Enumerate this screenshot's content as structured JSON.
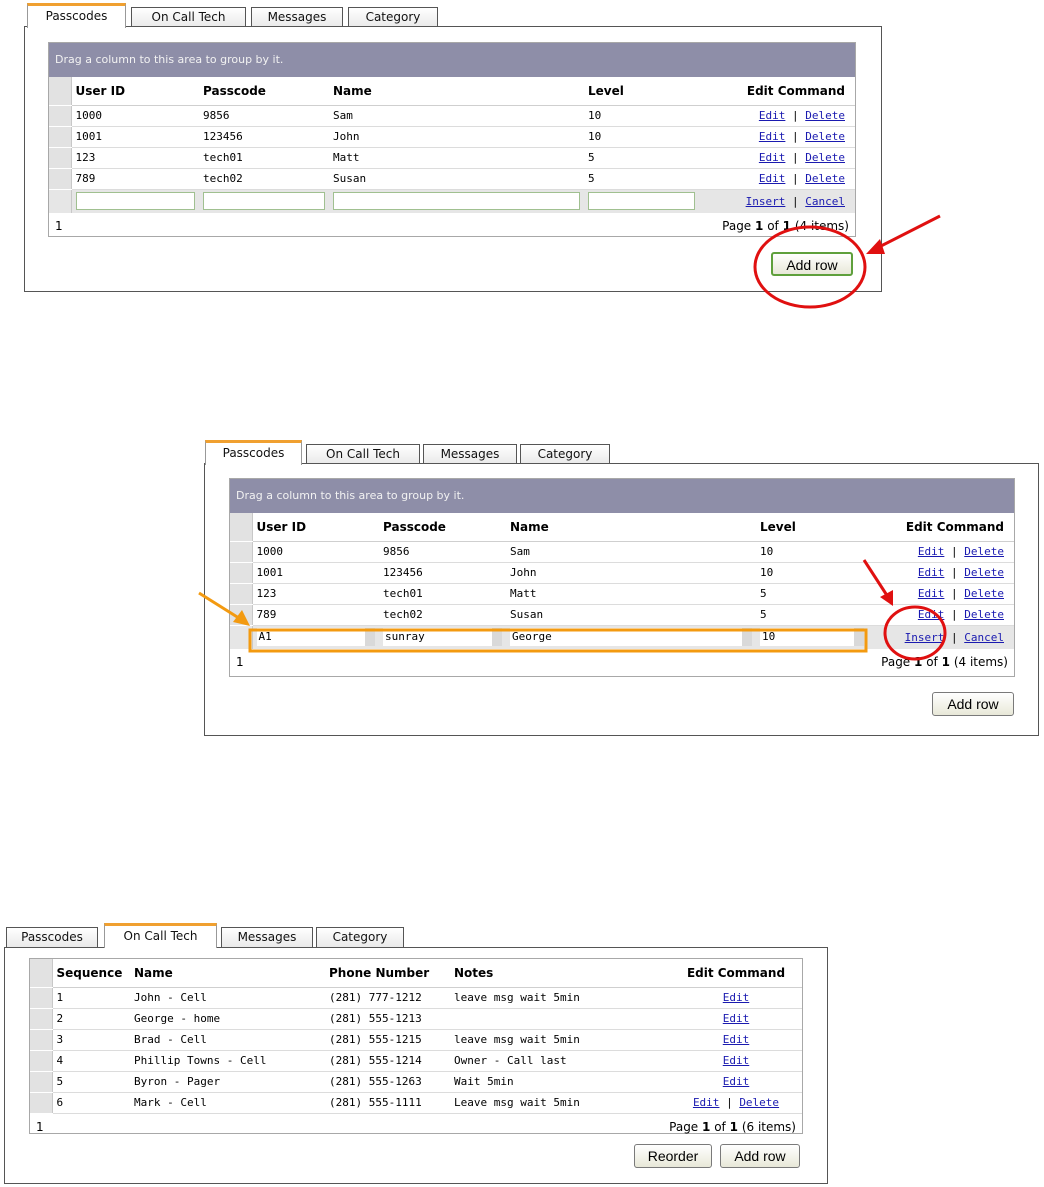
{
  "tabs": [
    "Passcodes",
    "On Call Tech",
    "Messages",
    "Category"
  ],
  "group_hint": "Drag a column to this area to group by it.",
  "passcode_grid": {
    "columns": [
      "User ID",
      "Passcode",
      "Name",
      "Level",
      "Edit Command"
    ],
    "rows": [
      {
        "user_id": "1000",
        "passcode": "9856",
        "name": "Sam",
        "level": "10"
      },
      {
        "user_id": "1001",
        "passcode": "123456",
        "name": "John",
        "level": "10"
      },
      {
        "user_id": "123",
        "passcode": "tech01",
        "name": "Matt",
        "level": "5"
      },
      {
        "user_id": "789",
        "passcode": "tech02",
        "name": "Susan",
        "level": "5"
      }
    ],
    "edit_label": "Edit",
    "delete_label": "Delete",
    "separator": "|",
    "insert_label": "Insert",
    "cancel_label": "Cancel",
    "pager_index": "1",
    "pager_page_word": "Page",
    "pager_page": "1",
    "pager_of_word": "of",
    "pager_total": "1",
    "pager_items": "(4 items)"
  },
  "filled_insert_row": {
    "user_id": "A1",
    "passcode": "sunray",
    "name": "George",
    "level": "10"
  },
  "oncall_grid": {
    "columns": [
      "Sequence",
      "Name",
      "Phone Number",
      "Notes",
      "Edit Command"
    ],
    "rows": [
      {
        "seq": "1",
        "name": "John - Cell",
        "phone": "(281) 777-1212",
        "notes": "leave msg wait 5min",
        "edit": "Edit",
        "delete": ""
      },
      {
        "seq": "2",
        "name": "George - home",
        "phone": "(281) 555-1213",
        "notes": "",
        "edit": "Edit",
        "delete": ""
      },
      {
        "seq": "3",
        "name": "Brad - Cell",
        "phone": "(281) 555-1215",
        "notes": "leave msg wait 5min",
        "edit": "Edit",
        "delete": ""
      },
      {
        "seq": "4",
        "name": "Phillip Towns - Cell",
        "phone": "(281) 555-1214",
        "notes": "Owner - Call last",
        "edit": "Edit",
        "delete": ""
      },
      {
        "seq": "5",
        "name": "Byron - Pager",
        "phone": "(281) 555-1263",
        "notes": "Wait 5min",
        "edit": "Edit",
        "delete": ""
      },
      {
        "seq": "6",
        "name": "Mark - Cell",
        "phone": "(281) 555-1111",
        "notes": "Leave msg wait 5min",
        "edit": "Edit",
        "delete": "Delete"
      }
    ],
    "pager_index": "1",
    "pager_page_word": "Page",
    "pager_page": "1",
    "pager_of_word": "of",
    "pager_total": "1",
    "pager_items": "(6 items)"
  },
  "buttons": {
    "add_row": "Add row",
    "reorder": "Reorder"
  },
  "colors": {
    "accent_tab": "#f0a030",
    "group_bar": "#8e8ea8",
    "annotation_red": "#e01010",
    "annotation_orange": "#f39a10",
    "link": "#1a1ab0"
  }
}
